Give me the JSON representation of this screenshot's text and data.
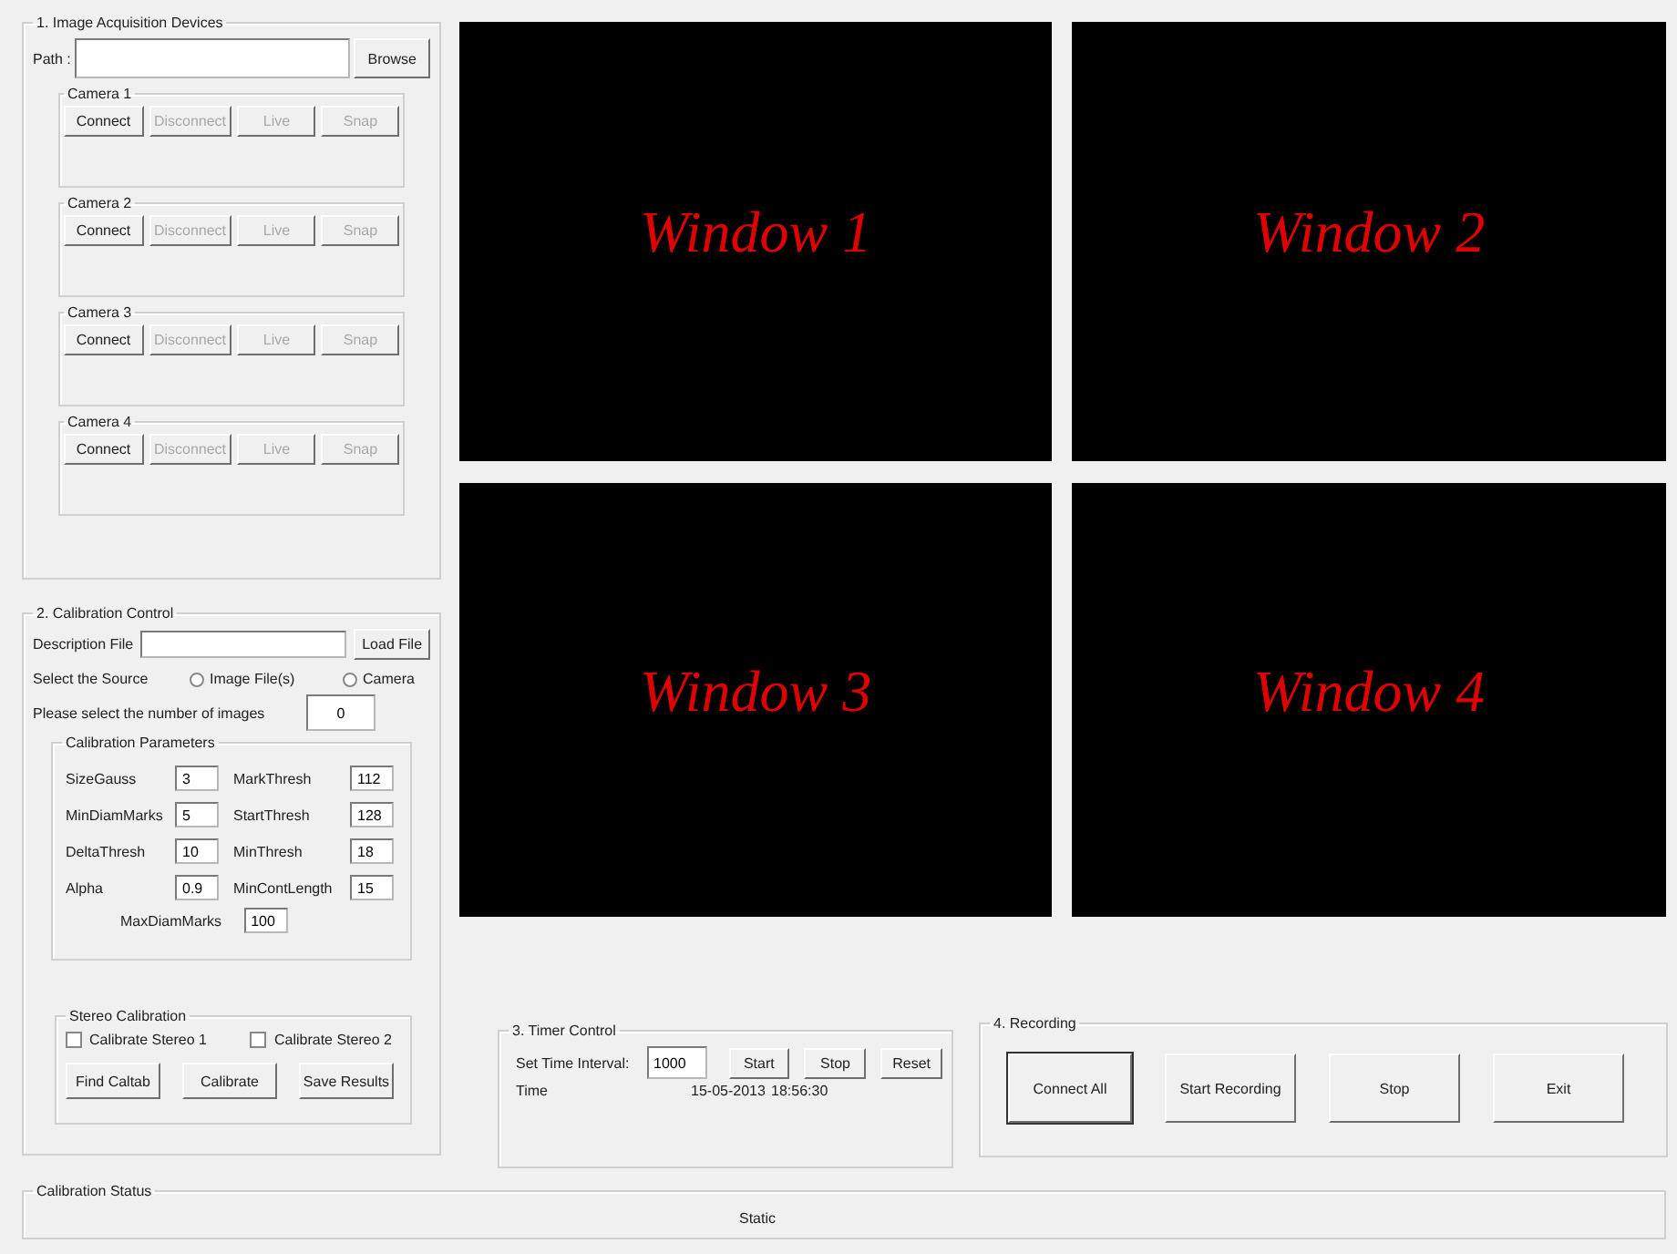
{
  "acquisition": {
    "title": "1. Image Acquisition Devices",
    "path_label": "Path :",
    "browse": "Browse",
    "cameras": [
      {
        "title": "Camera 1",
        "buttons": [
          {
            "label": "Connect",
            "disabled": false
          },
          {
            "label": "Disconnect",
            "disabled": true
          },
          {
            "label": "Live",
            "disabled": true
          },
          {
            "label": "Snap",
            "disabled": true
          }
        ]
      },
      {
        "title": "Camera 2",
        "buttons": [
          {
            "label": "Connect",
            "disabled": false
          },
          {
            "label": "Disconnect",
            "disabled": true
          },
          {
            "label": "Live",
            "disabled": true
          },
          {
            "label": "Snap",
            "disabled": true
          }
        ]
      },
      {
        "title": "Camera 3",
        "buttons": [
          {
            "label": "Connect",
            "disabled": false
          },
          {
            "label": "Disconnect",
            "disabled": true
          },
          {
            "label": "Live",
            "disabled": true
          },
          {
            "label": "Snap",
            "disabled": true
          }
        ]
      },
      {
        "title": "Camera 4",
        "buttons": [
          {
            "label": "Connect",
            "disabled": false
          },
          {
            "label": "Disconnect",
            "disabled": true
          },
          {
            "label": "Live",
            "disabled": true
          },
          {
            "label": "Snap",
            "disabled": true
          }
        ]
      }
    ]
  },
  "calibration": {
    "title": "2. Calibration Control",
    "description_label": "Description File",
    "load": "Load File",
    "source_label": "Select the Source",
    "sources": [
      {
        "label": "Image File(s)",
        "selected": false
      },
      {
        "label": "Camera",
        "selected": false
      }
    ],
    "count_label": "Please select the number of images",
    "count_value": "0",
    "params": {
      "title": "Calibration Parameters",
      "items": [
        {
          "label": "SizeGauss",
          "value": "3"
        },
        {
          "label": "MarkThresh",
          "value": "112"
        },
        {
          "label": "MinDiamMarks",
          "value": "5"
        },
        {
          "label": "StartThresh",
          "value": "128"
        },
        {
          "label": "DeltaThresh",
          "value": "10"
        },
        {
          "label": "MinThresh",
          "value": "18"
        },
        {
          "label": "Alpha",
          "value": "0.9"
        },
        {
          "label": "MinContLength",
          "value": "15"
        }
      ],
      "last": {
        "label": "MaxDiamMarks",
        "value": "100"
      }
    },
    "stereo": {
      "title": "Stereo Calibration",
      "checks": [
        {
          "label": "Calibrate Stereo 1",
          "checked": false
        },
        {
          "label": "Calibrate Stereo 2",
          "checked": false
        }
      ],
      "buttons": [
        "Find Caltab",
        "Calibrate",
        "Save Results"
      ]
    }
  },
  "windows": [
    {
      "label": "Window 1"
    },
    {
      "label": "Window 2"
    },
    {
      "label": "Window 3"
    },
    {
      "label": "Window 4"
    }
  ],
  "timer": {
    "title": "3. Timer Control",
    "interval_label": "Set Time Interval:",
    "interval_value": "1000",
    "buttons": [
      "Start",
      "Stop",
      "Reset"
    ],
    "time_label": "Time",
    "date": "15-05-2013",
    "clock": "18:56:30"
  },
  "recording": {
    "title": "4. Recording",
    "buttons": [
      {
        "label": "Connect All",
        "focused": true
      },
      {
        "label": "Start Recording",
        "focused": false
      },
      {
        "label": "Stop",
        "focused": false
      },
      {
        "label": "Exit",
        "focused": false
      }
    ]
  },
  "status": {
    "title": "Calibration Status",
    "text": "Static"
  }
}
